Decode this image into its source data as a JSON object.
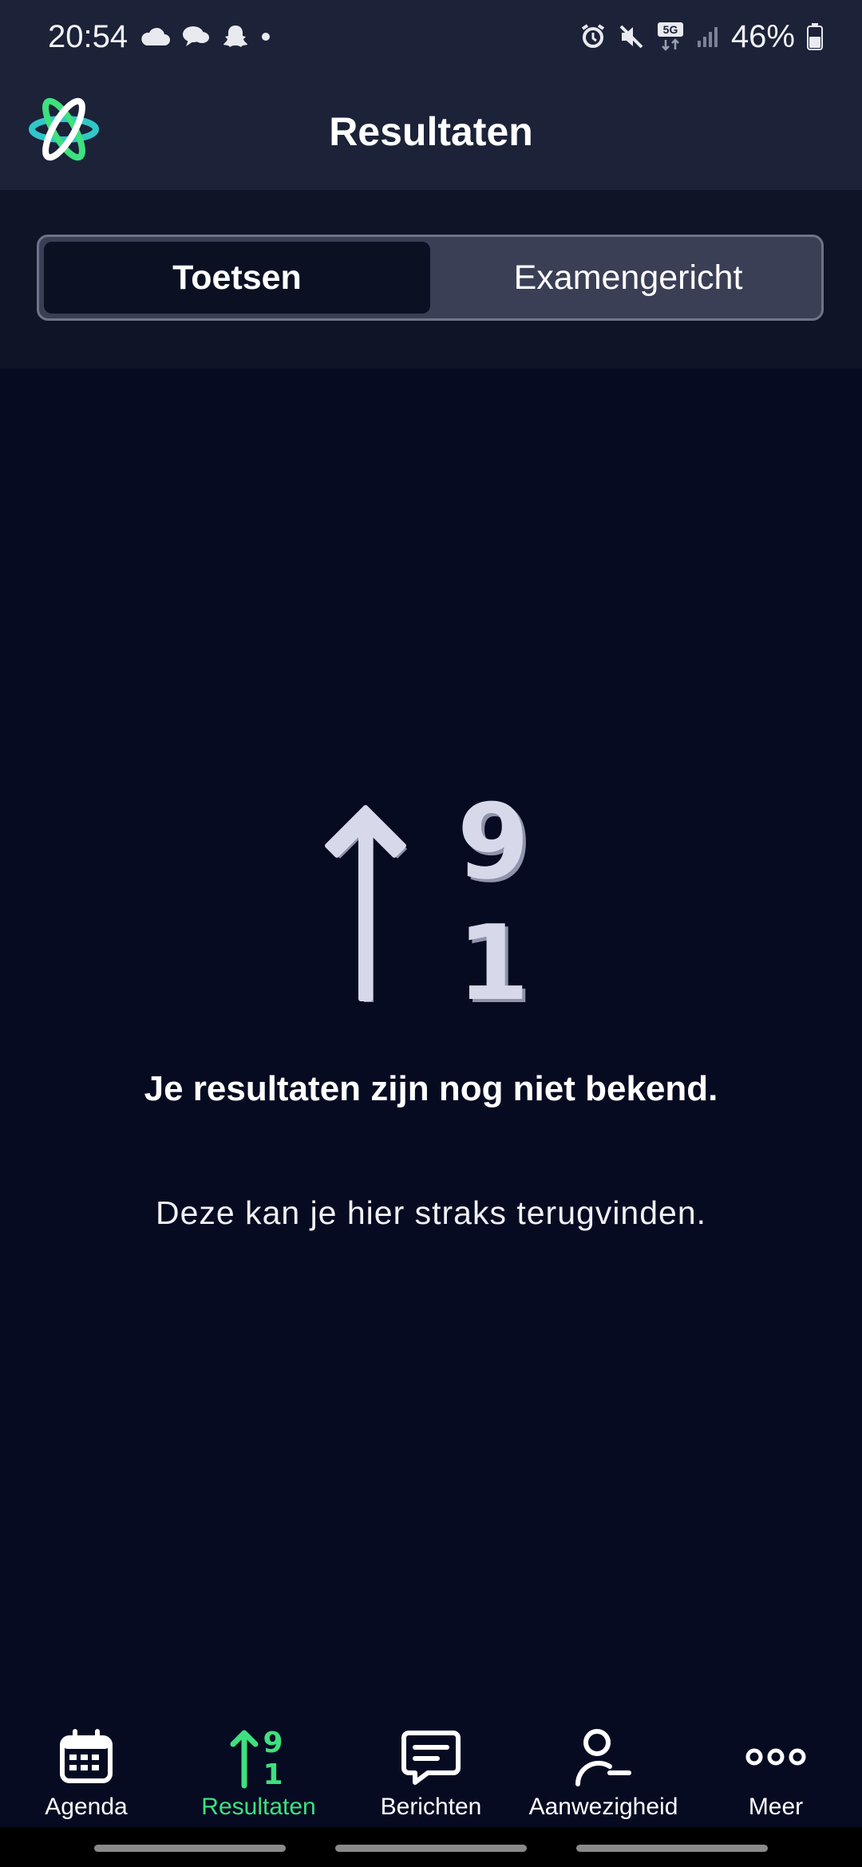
{
  "status_bar": {
    "time": "20:54",
    "battery": "46%",
    "network": "5G",
    "icons": [
      "cloud-icon",
      "chat-bubbles-icon",
      "snapchat-icon",
      "dot-icon",
      "alarm-icon",
      "mute-icon",
      "signal-icon",
      "battery-icon"
    ]
  },
  "header": {
    "title": "Resultaten"
  },
  "segments": {
    "tab1": "Toetsen",
    "tab2": "Examengericht",
    "active": "Toetsen"
  },
  "empty_state": {
    "title": "Je resultaten zijn nog niet bekend.",
    "subtitle": "Deze kan je hier straks terugvinden.",
    "illustration": "sort-numeric-icon"
  },
  "nav": {
    "items": [
      {
        "label": "Agenda",
        "icon": "calendar-icon"
      },
      {
        "label": "Resultaten",
        "icon": "results-icon"
      },
      {
        "label": "Berichten",
        "icon": "message-icon"
      },
      {
        "label": "Aanwezigheid",
        "icon": "person-icon"
      },
      {
        "label": "Meer",
        "icon": "more-icon"
      }
    ],
    "active_index": 1
  },
  "colors": {
    "accent": "#3ee07f",
    "background": "#070b22",
    "header": "#1c2238"
  }
}
